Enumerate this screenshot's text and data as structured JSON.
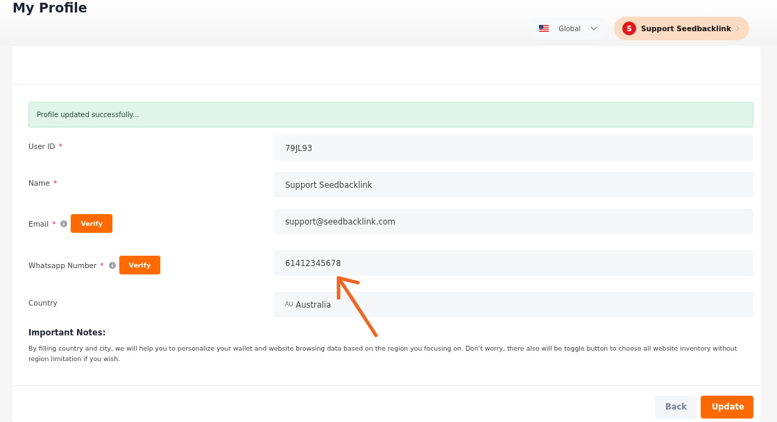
{
  "page_title": "My Profile",
  "region_selector": {
    "label": "Global"
  },
  "account_button": {
    "avatar_letter": "S",
    "name": "Support Seedbacklink"
  },
  "alert": {
    "message": "Profile updated successfully..."
  },
  "fields": [
    {
      "kind": "text",
      "label": "User ID",
      "required_mark": "*",
      "info": false,
      "value": "79JL93"
    },
    {
      "kind": "text",
      "label": "Name",
      "required_mark": "*",
      "info": false,
      "value": "Support Seedbacklink"
    },
    {
      "kind": "text",
      "label": "Email",
      "required_mark": "*",
      "info": true,
      "verify": "Verify",
      "value": "support@seedbacklink.com"
    },
    {
      "kind": "text",
      "label": "Whatsapp Number",
      "required_mark": "*",
      "info": true,
      "verify": "Verify",
      "value": "61412345678"
    },
    {
      "kind": "country",
      "label": "Country",
      "info": false,
      "code": "AU",
      "value": "Australia"
    }
  ],
  "notes": {
    "title": "Important Notes:",
    "body": "By filling country and city, we will help you to personalize your wallet and website browsing data based on the region you focusing on. Don't worry, there also will be toggle button to choose all website inventory without region limitation if you wish."
  },
  "buttons": [
    {
      "kind": "secondary",
      "label": "Back"
    },
    {
      "kind": "primary",
      "label": "Update"
    }
  ]
}
